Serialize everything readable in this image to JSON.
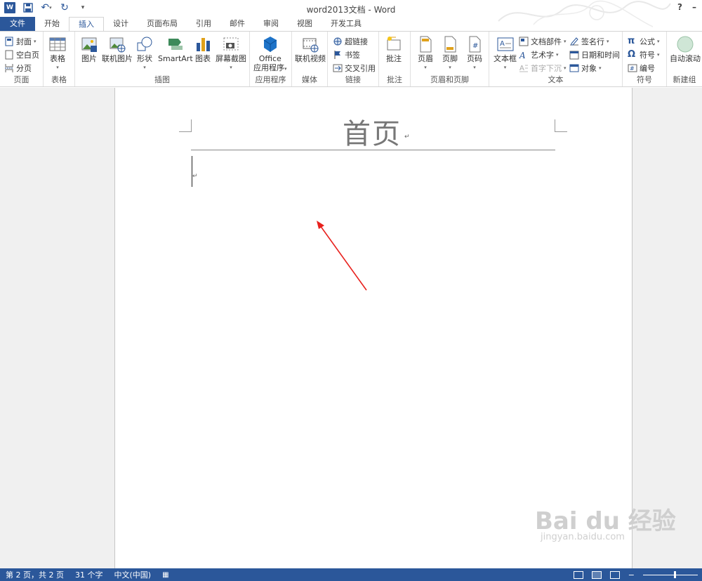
{
  "window": {
    "title": "word2013文档 - Word",
    "help": "?",
    "minimize": "–",
    "restore": "□"
  },
  "tabs": [
    {
      "label": "文件"
    },
    {
      "label": "开始"
    },
    {
      "label": "插入"
    },
    {
      "label": "设计"
    },
    {
      "label": "页面布局"
    },
    {
      "label": "引用"
    },
    {
      "label": "邮件"
    },
    {
      "label": "审阅"
    },
    {
      "label": "视图"
    },
    {
      "label": "开发工具"
    }
  ],
  "ribbon": {
    "pages": {
      "label": "页面",
      "cover": "封面",
      "blank": "空白页",
      "break": "分页"
    },
    "tables": {
      "label": "表格",
      "table": "表格"
    },
    "illustrations": {
      "label": "插图",
      "picture": "图片",
      "online_picture": "联机图片",
      "shapes": "形状",
      "smartart": "SmartArt",
      "chart": "图表",
      "screenshot": "屏幕截图"
    },
    "apps": {
      "label": "应用程序",
      "office_line1": "Office",
      "office_line2": "应用程序"
    },
    "media": {
      "label": "媒体",
      "online_video": "联机视频"
    },
    "links": {
      "label": "链接",
      "hyperlink": "超链接",
      "bookmark": "书签",
      "cross_ref": "交叉引用"
    },
    "comments": {
      "label": "批注",
      "comment": "批注"
    },
    "header_footer": {
      "label": "页眉和页脚",
      "header": "页眉",
      "footer": "页脚",
      "page_number": "页码"
    },
    "text": {
      "label": "文本",
      "textbox": "文本框",
      "quick_parts": "文档部件",
      "wordart": "艺术字",
      "dropcap": "首字下沉",
      "signature": "签名行",
      "datetime": "日期和时间",
      "object": "对象"
    },
    "symbols": {
      "label": "符号",
      "equation": "公式",
      "symbol": "符号",
      "number": "编号"
    },
    "new_group": {
      "label": "新建组",
      "auto_scroll": "自动滚动"
    }
  },
  "document": {
    "header_text": "首页",
    "para_mark": "↵"
  },
  "status": {
    "page": "第 2 页，共 2 页",
    "words": "31 个字",
    "lang": "中文(中国)"
  },
  "watermark": {
    "brand": "Bai du 经验",
    "url": "jingyan.baidu.com"
  },
  "colors": {
    "accent": "#2b579a",
    "arrow": "#e8211d"
  }
}
